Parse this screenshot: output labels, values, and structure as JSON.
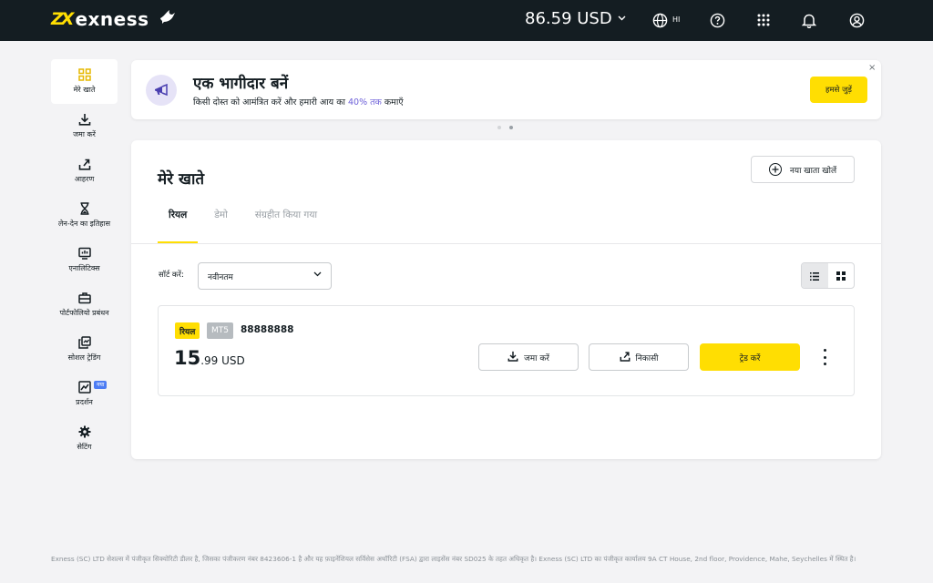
{
  "header": {
    "brand": "exness",
    "brand_mark": "ZX",
    "balance": "86.59 USD",
    "language_code": "HI",
    "icons": [
      "globe-icon",
      "help-icon",
      "apps-grid-icon",
      "bell-icon",
      "profile-icon"
    ]
  },
  "sidebar": {
    "items": [
      {
        "label": "मेरे खाते",
        "icon": "accounts-grid-icon",
        "active": true
      },
      {
        "label": "जमा करें",
        "icon": "download-icon"
      },
      {
        "label": "आहरण",
        "icon": "upload-icon"
      },
      {
        "label": "लेन-देन का इतिहास",
        "icon": "hourglass-icon"
      },
      {
        "label": "एनालिटिक्स",
        "icon": "analytics-icon"
      },
      {
        "label": "पोर्टफोलियो प्रबंधन",
        "icon": "briefcase-icon"
      },
      {
        "label": "सोशल ट्रेडिंग",
        "icon": "copy-icon"
      },
      {
        "label": "प्रदर्शन",
        "icon": "chart-icon",
        "badge": "नया"
      },
      {
        "label": "सेटिंग",
        "icon": "gear-icon"
      }
    ]
  },
  "banner": {
    "title": "एक भागीदार बनें",
    "subtitle_before": "किसी दोस्त को आमंत्रित करें और हमारी आय का ",
    "subtitle_highlight": "40% तक",
    "subtitle_after": " कमाएँ",
    "button": "हमसे जुड़ें",
    "close": "×",
    "highlight_color": "#6c5fd8"
  },
  "main": {
    "title": "मेरे खाते",
    "new_account_button": "नया खाता खोलें",
    "tabs": [
      {
        "label": "रियल",
        "active": true
      },
      {
        "label": "डेमो"
      },
      {
        "label": "संग्रहीत किया गया"
      }
    ],
    "sort_label": "सॉर्ट करें:",
    "sort_value": "नवीनतम"
  },
  "account": {
    "type_tag": "रियल",
    "platform_tag": "MT5",
    "number": "88888888",
    "balance_int": "15",
    "balance_dec": ".99",
    "currency": " USD",
    "deposit_button": "जमा करें",
    "withdraw_button": "निकासी",
    "trade_button": "ट्रेड करें"
  },
  "footer": {
    "text": "Exness (SC) LTD सेशल्स में पंजीकृत सिक्योरिटी डीलर है, जिसका पंजीकरण नंबर 8423606-1 है और यह फ़ाइनेंशियल सर्विसेस अथॉरिटी (FSA) द्वारा लाइसेंस नंबर SD025 के तहत अधिकृत है। Exness (SC) LTD का पंजीकृत कार्यालय 9A CT House, 2nd floor, Providence, Mahe, Seychelles में स्थित है।"
  },
  "colors": {
    "accent": "#ffde02",
    "topbar": "#141d22",
    "background": "#f3f3f5"
  }
}
